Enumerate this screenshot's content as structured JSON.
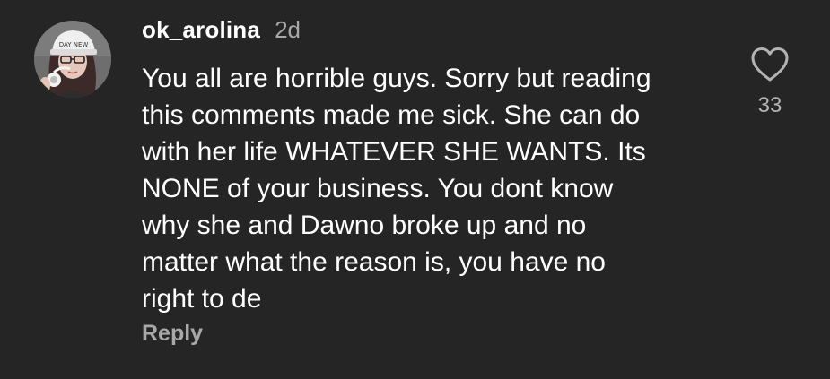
{
  "comment": {
    "username": "ok_arolina",
    "timestamp": "2d",
    "text": "You all are horrible guys. Sorry but reading\nthis comments made me sick. She can do\nwith her life WHATEVER SHE WANTS. Its\nNONE of your business. You dont know\nwhy she and Dawno broke up and no\nmatter what the reason is, you have no\nright to de",
    "reply_label": "Reply",
    "like_count": "33",
    "like_icon": "heart-outline-icon",
    "avatar_cap_text": "DAY NEW"
  },
  "colors": {
    "background": "#252525",
    "text_primary": "#ffffff",
    "text_secondary": "#a8a8a8"
  }
}
